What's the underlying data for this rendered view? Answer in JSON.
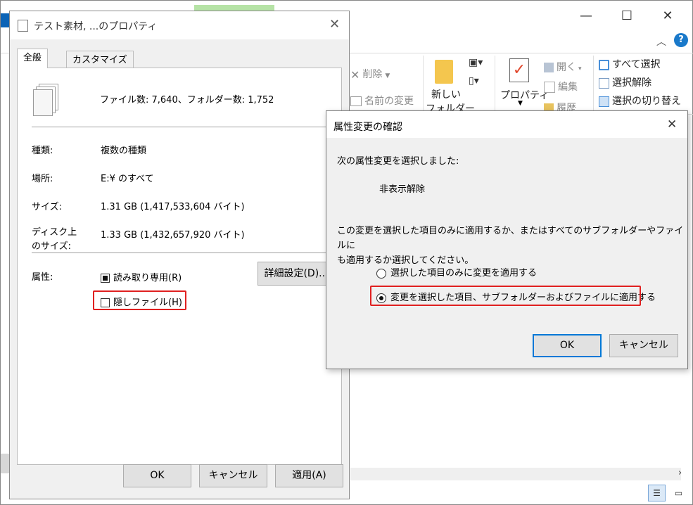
{
  "explorer": {
    "window_controls": {
      "minimize": "—",
      "maximize": "☐",
      "close": "✕"
    },
    "help": "?",
    "ribbon": {
      "delete_label": "削除",
      "rename_label": "名前の変更",
      "new_folder_label1": "新しい",
      "new_folder_label2": "フォルダー",
      "properties_label": "プロパティ",
      "open_label": "開く",
      "edit_label": "編集",
      "history_label": "履歴",
      "select_all_label": "すべて選択",
      "select_none_label": "選択解除",
      "invert_selection_label": "選択の切り替え"
    }
  },
  "properties_dialog": {
    "title": "テスト素材, ...のプロパティ",
    "tabs": [
      "全般",
      "カスタマイズ"
    ],
    "summary": "ファイル数: 7,640、フォルダー数: 1,752",
    "type_label": "種類:",
    "type_value": "複数の種類",
    "location_label": "場所:",
    "location_value": "E:¥ のすべて",
    "size_label": "サイズ:",
    "size_value": "1.31 GB (1,417,533,604 バイト)",
    "disk_size_label1": "ディスク上",
    "disk_size_label2": "のサイズ:",
    "disk_size_value": "1.33 GB (1,432,657,920 バイト)",
    "attributes_label": "属性:",
    "readonly_label": "読み取り専用(R)",
    "hidden_label": "隠しファイル(H)",
    "advanced_button": "詳細設定(D)...",
    "ok_button": "OK",
    "cancel_button": "キャンセル",
    "apply_button": "適用(A)"
  },
  "confirm_dialog": {
    "title": "属性変更の確認",
    "intro": "次の属性変更を選択しました:",
    "change": "非表示解除",
    "question_line1": "この変更を選択した項目のみに適用するか、またはすべてのサブフォルダーやファイルに",
    "question_line2": "も適用するか選択してください。",
    "option_selected_only": "選択した項目のみに変更を適用する",
    "option_all": "変更を選択した項目、サブフォルダーおよびファイルに適用する",
    "ok_button": "OK",
    "cancel_button": "キャンセル"
  },
  "colors": {
    "highlight_red": "#e02020",
    "accent_blue": "#0078d7",
    "help_blue": "#1979ca"
  }
}
